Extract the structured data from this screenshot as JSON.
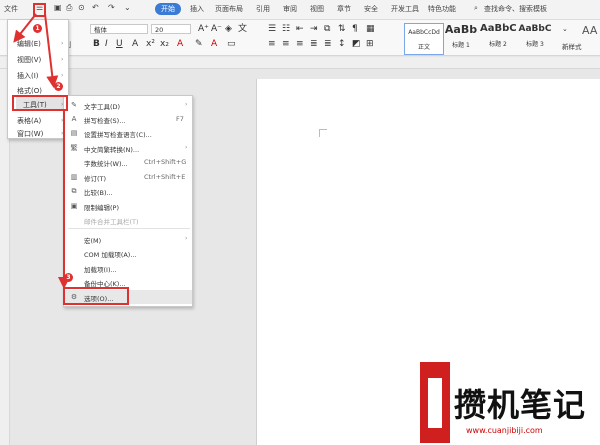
{
  "tabs": {
    "file": "文件",
    "items": [
      "开始",
      "插入",
      "页面布局",
      "引用",
      "审阅",
      "视图",
      "章节",
      "安全",
      "开发工具",
      "特色功能"
    ],
    "active_index": 0,
    "search": "查找命令、搜索模板"
  },
  "ribbon": {
    "font_name": "楷体",
    "font_size": "20",
    "styles": [
      {
        "preview": "AaBbCcDd",
        "label": "正文"
      },
      {
        "preview": "AaBb",
        "label": "标题 1"
      },
      {
        "preview": "AaBbC",
        "label": "标题 2"
      },
      {
        "preview": "AaBbC",
        "label": "标题 3"
      }
    ],
    "new_style": "新样式",
    "format_painter": "式刷",
    "text_tool_icon": "AA"
  },
  "file_menu": {
    "items": [
      {
        "label": "编辑(E)"
      },
      {
        "label": "视图(V)"
      },
      {
        "label": "插入(I)"
      },
      {
        "label": "格式(O)"
      },
      {
        "label": "工具(T)"
      },
      {
        "label": "表格(A)"
      },
      {
        "label": "窗口(W)"
      }
    ]
  },
  "tools_menu": {
    "items": [
      {
        "icon": "text-tool-icon",
        "label": "文字工具(D)",
        "shortcut": "",
        "arrow": true
      },
      {
        "icon": "spell-check-icon",
        "label": "拼写检查(S)...",
        "shortcut": "F7"
      },
      {
        "icon": "",
        "label": "设置拼写检查语言(C)...",
        "shortcut": ""
      },
      {
        "icon": "chinese-convert-icon",
        "label": "中文简繁转换(N)...",
        "shortcut": "",
        "arrow": true
      },
      {
        "icon": "",
        "label": "字数统计(W)...",
        "shortcut": "Ctrl+Shift+G"
      },
      {
        "icon": "revision-icon",
        "label": "修订(T)",
        "shortcut": "Ctrl+Shift+E"
      },
      {
        "icon": "compare-icon",
        "label": "比较(B)...",
        "shortcut": ""
      },
      {
        "icon": "restrict-edit-icon",
        "label": "限制编辑(P)",
        "shortcut": ""
      },
      {
        "icon": "",
        "label": "邮件合并工具栏(T)",
        "shortcut": "",
        "disabled": true
      },
      {
        "icon": "",
        "label": "宏(M)",
        "shortcut": "",
        "arrow": true
      },
      {
        "icon": "",
        "label": "COM 加载项(A)...",
        "shortcut": ""
      },
      {
        "icon": "",
        "label": "加载项(I)...",
        "shortcut": ""
      },
      {
        "icon": "",
        "label": "备份中心(K)...",
        "shortcut": ""
      },
      {
        "icon": "gear-icon",
        "label": "选项(O)...",
        "shortcut": ""
      }
    ]
  },
  "steps": [
    "1",
    "2",
    "3"
  ],
  "watermark": {
    "title": "攒机笔记",
    "url": "www.cuanjibiji.com"
  },
  "colors": {
    "accent": "#3a7bd5",
    "highlight": "#e03131"
  }
}
